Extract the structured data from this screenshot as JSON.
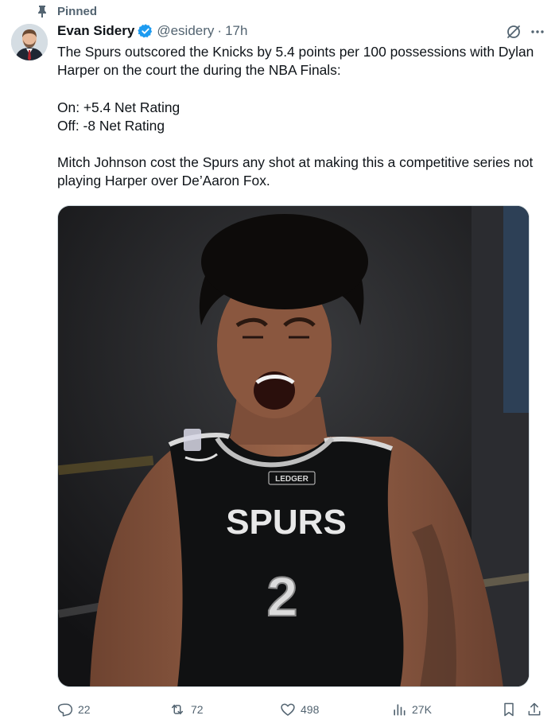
{
  "pinned": {
    "label": "Pinned",
    "icon": "pin-icon"
  },
  "author": {
    "name": "Evan Sidery",
    "handle": "@esidery",
    "separator": "·",
    "time": "17h",
    "verified_icon": "verified-badge-icon",
    "verified_color": "#1d9bf0"
  },
  "tweet": {
    "text": "The Spurs outscored the Knicks by 5.4 points per 100 possessions with Dylan Harper on the court the during the NBA Finals:\n\nOn: +5.4 Net Rating\nOff: -8 Net Rating\n\nMitch Johnson cost the Spurs any shot at making this a competitive series not playing Harper over De’Aaron Fox."
  },
  "media": {
    "jersey": {
      "team": "SPURS",
      "number": "2",
      "sponsor": "LEDGER"
    }
  },
  "actions": {
    "replies": "22",
    "reposts": "72",
    "likes": "498",
    "views": "27K"
  },
  "colors": {
    "text": "#0f1419",
    "secondary": "#536471",
    "border": "#cfd9de"
  }
}
